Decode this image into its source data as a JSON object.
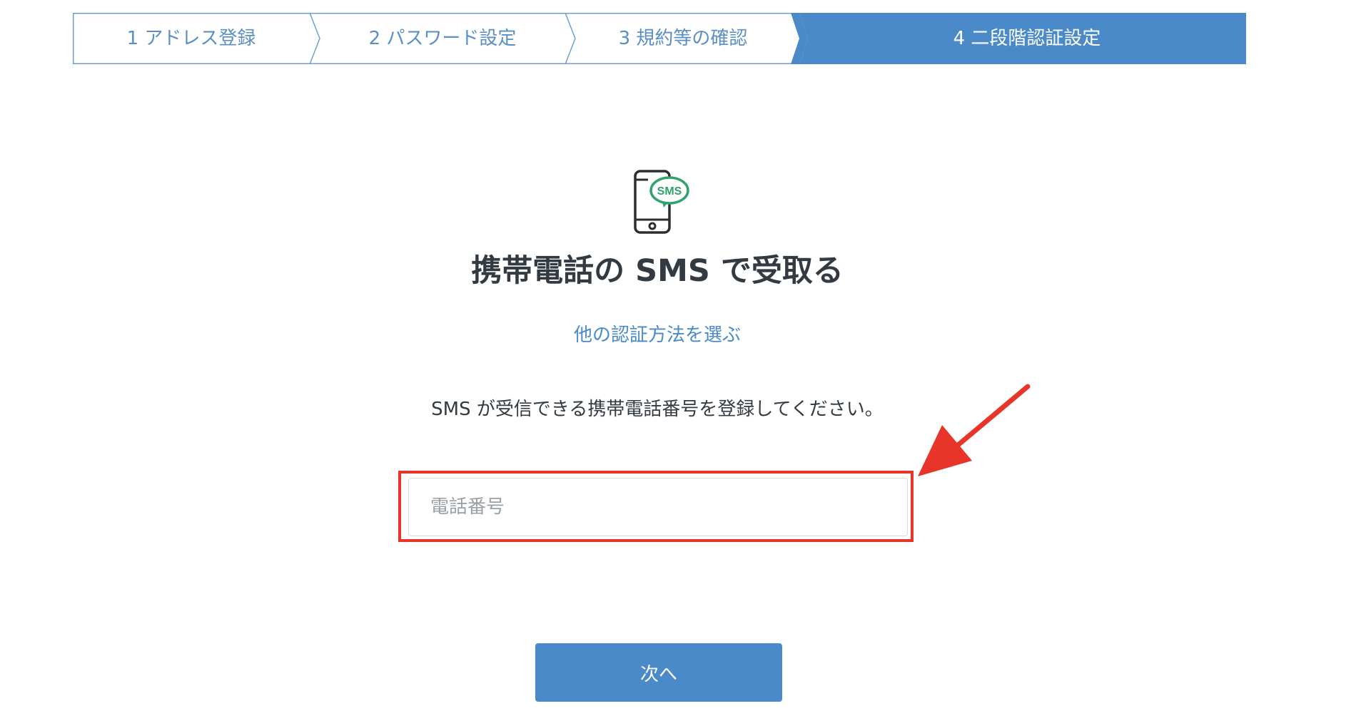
{
  "stepper": {
    "steps": [
      {
        "label": "1 アドレス登録",
        "state": "done"
      },
      {
        "label": "2 パスワード設定",
        "state": "done"
      },
      {
        "label": "3 規約等の確認",
        "state": "done"
      },
      {
        "label": "4 二段階認証設定",
        "state": "active"
      }
    ]
  },
  "main": {
    "icon": "phone-sms-icon",
    "icon_badge": "SMS",
    "title": "携帯電話の SMS で受取る",
    "other_method_link": "他の認証方法を選ぶ",
    "instruction": "SMS が受信できる携帯電話番号を登録してください。",
    "phone_input": {
      "value": "",
      "placeholder": "電話番号"
    },
    "next_button": "次へ"
  },
  "annotation": {
    "highlight_color": "#e8352a",
    "arrow_icon": "red-arrow-icon"
  },
  "colors": {
    "accent": "#4a8ac8",
    "step_inactive_text": "#5a8fc4",
    "sms_green": "#2fa36b",
    "title_text": "#333a42"
  }
}
